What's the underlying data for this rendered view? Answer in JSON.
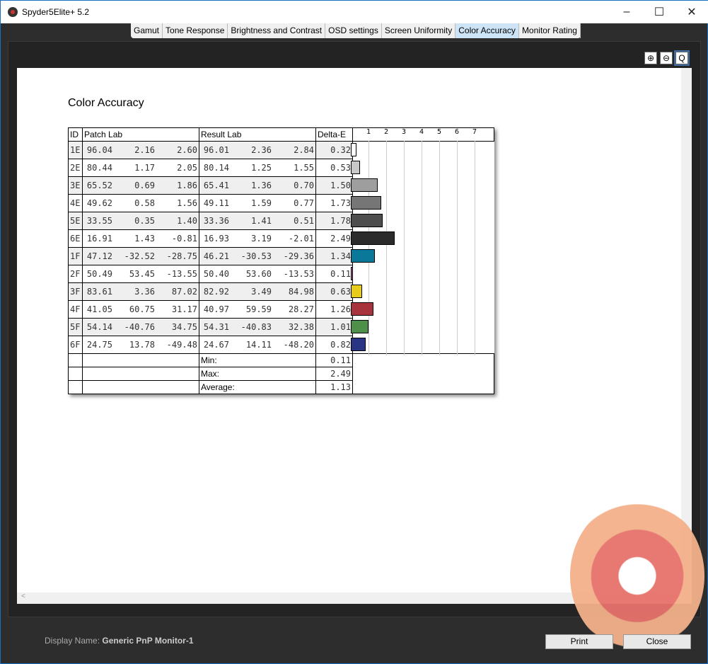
{
  "window": {
    "title": "Spyder5Elite+ 5.2",
    "minimize": "–",
    "maximize": "☐",
    "close": "✕"
  },
  "tabs": [
    "Gamut",
    "Tone Response",
    "Brightness and Contrast",
    "OSD settings",
    "Screen Uniformity",
    "Color Accuracy",
    "Monitor Rating"
  ],
  "active_tab": "Color Accuracy",
  "zoom": {
    "in": "⊕",
    "out": "⊖",
    "fit": "Q"
  },
  "heading": "Color Accuracy",
  "table": {
    "headers": {
      "id": "ID",
      "patch": "Patch Lab",
      "result": "Result Lab",
      "delta": "Delta-E"
    },
    "rows": [
      {
        "id": "1E",
        "patch": [
          "96.04",
          "2.16",
          "2.60"
        ],
        "result": [
          "96.01",
          "2.36",
          "2.84"
        ],
        "delta": "0.32",
        "value": 0.32,
        "color": "#ffffff"
      },
      {
        "id": "2E",
        "patch": [
          "80.44",
          "1.17",
          "2.05"
        ],
        "result": [
          "80.14",
          "1.25",
          "1.55"
        ],
        "delta": "0.53",
        "value": 0.53,
        "color": "#c8c8c8"
      },
      {
        "id": "3E",
        "patch": [
          "65.52",
          "0.69",
          "1.86"
        ],
        "result": [
          "65.41",
          "1.36",
          "0.70"
        ],
        "delta": "1.50",
        "value": 1.5,
        "color": "#9e9e9e"
      },
      {
        "id": "4E",
        "patch": [
          "49.62",
          "0.58",
          "1.56"
        ],
        "result": [
          "49.11",
          "1.59",
          "0.77"
        ],
        "delta": "1.73",
        "value": 1.73,
        "color": "#767676"
      },
      {
        "id": "5E",
        "patch": [
          "33.55",
          "0.35",
          "1.40"
        ],
        "result": [
          "33.36",
          "1.41",
          "0.51"
        ],
        "delta": "1.78",
        "value": 1.78,
        "color": "#4e4e4e"
      },
      {
        "id": "6E",
        "patch": [
          "16.91",
          "1.43",
          "-0.81"
        ],
        "result": [
          "16.93",
          "3.19",
          "-2.01"
        ],
        "delta": "2.49",
        "value": 2.49,
        "color": "#2b2b2b"
      },
      {
        "id": "1F",
        "patch": [
          "47.12",
          "-32.52",
          "-28.75"
        ],
        "result": [
          "46.21",
          "-30.53",
          "-29.36"
        ],
        "delta": "1.34",
        "value": 1.34,
        "color": "#0a7899"
      },
      {
        "id": "2F",
        "patch": [
          "50.49",
          "53.45",
          "-13.55"
        ],
        "result": [
          "50.40",
          "53.60",
          "-13.53"
        ],
        "delta": "0.11",
        "value": 0.11,
        "color": "#b8569a"
      },
      {
        "id": "3F",
        "patch": [
          "83.61",
          "3.36",
          "87.02"
        ],
        "result": [
          "82.92",
          "3.49",
          "84.98"
        ],
        "delta": "0.63",
        "value": 0.63,
        "color": "#e8cc1a"
      },
      {
        "id": "4F",
        "patch": [
          "41.05",
          "60.75",
          "31.17"
        ],
        "result": [
          "40.97",
          "59.59",
          "28.27"
        ],
        "delta": "1.26",
        "value": 1.26,
        "color": "#a8333c"
      },
      {
        "id": "5F",
        "patch": [
          "54.14",
          "-40.76",
          "34.75"
        ],
        "result": [
          "54.31",
          "-40.83",
          "32.38"
        ],
        "delta": "1.01",
        "value": 1.01,
        "color": "#4e8f4a"
      },
      {
        "id": "6F",
        "patch": [
          "24.75",
          "13.78",
          "-49.48"
        ],
        "result": [
          "24.67",
          "14.11",
          "-48.20"
        ],
        "delta": "0.82",
        "value": 0.82,
        "color": "#2a3484"
      }
    ],
    "summary": [
      {
        "label": "Min:",
        "value": "0.11"
      },
      {
        "label": "Max:",
        "value": "2.49"
      },
      {
        "label": "Average:",
        "value": "1.13"
      }
    ],
    "scale_ticks": [
      "1",
      "2",
      "3",
      "4",
      "5",
      "6",
      "7"
    ]
  },
  "footer": {
    "display_label": "Display Name:",
    "display_name": "Generic PnP Monitor-1",
    "print": "Print",
    "close": "Close"
  }
}
